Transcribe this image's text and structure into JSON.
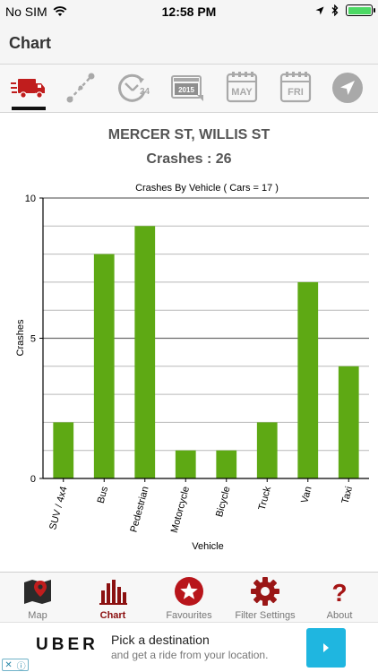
{
  "status_bar": {
    "carrier": "No SIM",
    "time": "12:58 PM"
  },
  "nav": {
    "title": "Chart"
  },
  "filters": [
    {
      "icon": "truck-icon",
      "active": true
    },
    {
      "icon": "route-icon",
      "active": false
    },
    {
      "icon": "clock-24-icon",
      "active": false,
      "label": "24"
    },
    {
      "icon": "year-calendar-icon",
      "active": false,
      "label": "2015"
    },
    {
      "icon": "month-calendar-icon",
      "active": false,
      "label": "MAY"
    },
    {
      "icon": "weekday-calendar-icon",
      "active": false,
      "label": "FRI"
    },
    {
      "icon": "location-arrow-icon",
      "active": false
    }
  ],
  "location": "MERCER ST, WILLIS ST",
  "crashes_summary": "Crashes : 26",
  "chart_data": {
    "type": "bar",
    "title": "Crashes By Vehicle ( Cars = 17 )",
    "xlabel": "Vehicle",
    "ylabel": "Crashes",
    "categories": [
      "SUV / 4x4",
      "Bus",
      "Pedestrian",
      "Motorcycle",
      "Bicycle",
      "Truck",
      "Van",
      "Taxi"
    ],
    "values": [
      2,
      8,
      9,
      1,
      1,
      2,
      7,
      4
    ],
    "ylim": [
      0,
      10
    ],
    "yticks": [
      0,
      5,
      10
    ],
    "grid": true,
    "bar_color": "#5ea914"
  },
  "tabs": [
    {
      "label": "Map",
      "icon": "map-icon",
      "active": false
    },
    {
      "label": "Chart",
      "icon": "bar-chart-icon",
      "active": true
    },
    {
      "label": "Favourites",
      "icon": "star-icon",
      "active": false
    },
    {
      "label": "Filter Settings",
      "icon": "gear-icon",
      "active": false
    },
    {
      "label": "About",
      "icon": "question-icon",
      "active": false
    }
  ],
  "ad": {
    "brand": "UBER",
    "headline": "Pick a destination",
    "subline": "and get a ride from your location."
  },
  "colors": {
    "accent": "#8b1010",
    "bar": "#5ea914",
    "ad_cta": "#1fb6e0"
  }
}
